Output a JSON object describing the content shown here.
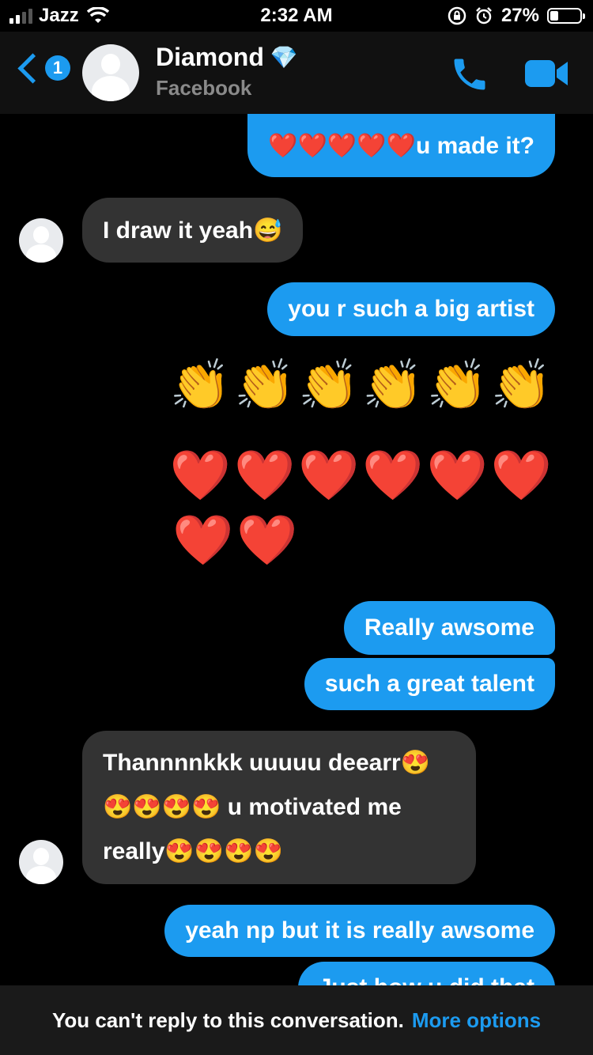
{
  "status_bar": {
    "carrier": "Jazz",
    "time": "2:32 AM",
    "battery": "27%"
  },
  "header": {
    "unread_count": "1",
    "contact_name": "Diamond",
    "contact_emoji": "💎",
    "subtitle": "Facebook"
  },
  "messages": {
    "m1": "❤️❤️❤️❤️❤️u made it?",
    "m2": "I draw it yeah😅",
    "m3": "you r such a big artist",
    "m4": "👏👏👏👏👏👏",
    "m5a": "❤️❤️❤️❤️❤️❤️",
    "m5b": "❤️❤️",
    "m6": "Really awsome",
    "m7": "such a great talent",
    "m8_line1": "Thannnnkkk uuuuu deearr😍",
    "m8_line2": "😍😍😍😍 u motivated me",
    "m8_line3": "really😍😍😍😍",
    "m9": "yeah np but it is really awsome",
    "m10": "Just how u did that"
  },
  "footer": {
    "notice": "You can't reply to this conversation.",
    "link": "More options"
  },
  "colors": {
    "accent": "#1c9bf0",
    "incoming_bubble": "#333333",
    "background": "#000000"
  }
}
